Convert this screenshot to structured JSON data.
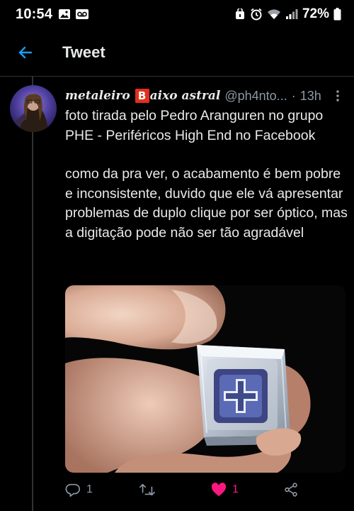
{
  "status_bar": {
    "time": "10:54",
    "battery": "72%"
  },
  "header": {
    "title": "Tweet"
  },
  "tweet": {
    "author_prefix": "metaleiro ",
    "author_badge": "B",
    "author_suffix": "aixo astral",
    "handle": "@ph4nto...",
    "separator": "·",
    "time": "13h",
    "paragraphs": [
      "foto tirada pelo Pedro Aranguren no grupo PHE - Periféricos High End no Facebook",
      "como da pra ver, o acabamento é bem pobre e inconsistente, duvido que ele vá apresentar problemas de duplo clique por ser óptico, mas a digitação pode não ser tão agradável"
    ],
    "replies": "1",
    "retweets": "",
    "likes": "1"
  },
  "colors": {
    "accent": "#1d9bf0",
    "like": "#f91880",
    "muted": "#8b98a5",
    "divider": "#2f3336"
  },
  "icons": [
    "back-arrow-icon",
    "more-vertical-icon",
    "reply-icon",
    "retweet-icon",
    "heart-icon",
    "share-icon"
  ]
}
